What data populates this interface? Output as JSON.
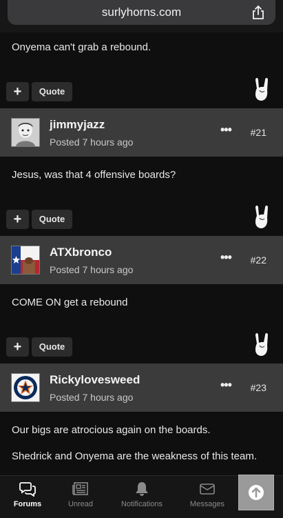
{
  "browser": {
    "url": "surlyhorns.com"
  },
  "top_post": {
    "text": "Onyema can't grab a rebound."
  },
  "actions": {
    "plus_label": "+",
    "quote_label": "Quote"
  },
  "posts": [
    {
      "username": "jimmyjazz",
      "posted": "Posted 7 hours ago",
      "more": "•••",
      "number": "#21",
      "text": "Jesus, was that 4 offensive boards?"
    },
    {
      "username": "ATXbronco",
      "posted": "Posted 7 hours ago",
      "more": "•••",
      "number": "#22",
      "text": "COME ON get a rebound"
    },
    {
      "username": "Rickylovesweed",
      "posted": "Posted 7 hours ago",
      "more": "•••",
      "number": "#23",
      "text": "Our bigs are atrocious again on the boards.",
      "text2": "Shedrick and Onyema are the weakness of this team."
    }
  ],
  "tabs": [
    {
      "label": "Forums",
      "icon": "chat-bubbles-icon",
      "active": true
    },
    {
      "label": "Unread",
      "icon": "newspaper-icon"
    },
    {
      "label": "Notifications",
      "icon": "bell-icon"
    },
    {
      "label": "Messages",
      "icon": "envelope-icon"
    }
  ],
  "colors": {
    "background": "#0f0f0f",
    "header": "#3b3b3b",
    "button": "#2c2c2c"
  }
}
